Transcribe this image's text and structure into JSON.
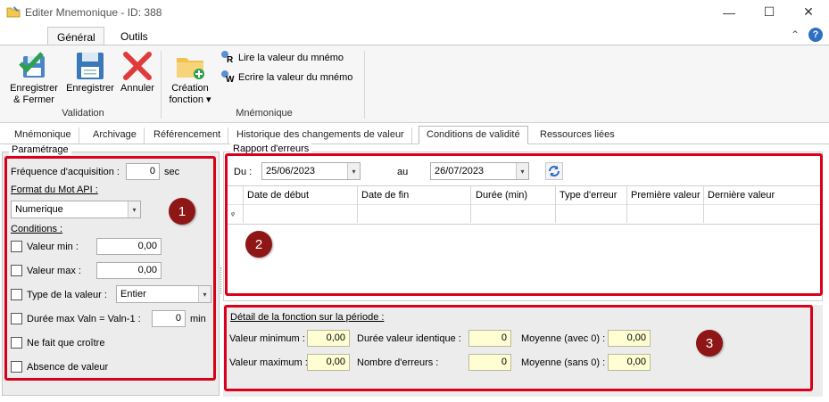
{
  "window": {
    "title": "Editer Mnemonique - ID: 388",
    "minimize": "—",
    "maximize": "☐",
    "close": "✕"
  },
  "ribbon": {
    "tabs": [
      "Général",
      "Outils"
    ],
    "collapse_glyph": "⌃",
    "help_glyph": "?",
    "validation": {
      "group_label": "Validation",
      "save_close": [
        "Enregistrer",
        "& Fermer"
      ],
      "save": "Enregistrer",
      "cancel": "Annuler"
    },
    "mnemonique": {
      "group_label": "Mnémonique",
      "create_function": [
        "Création",
        "fonction"
      ],
      "dropdown_glyph": "▾",
      "read_value": "Lire la valeur du mnémo",
      "write_value": "Ecrire la valeur du mnémo",
      "read_letter": "R",
      "write_letter": "W"
    }
  },
  "tabs": [
    "Mnémonique",
    "Archivage",
    "Référencement",
    "Historique des changements de valeur",
    "Conditions de validité",
    "Ressources liées"
  ],
  "active_tab_index": 4,
  "parametrage": {
    "title": "Paramétrage",
    "frequency_label": "Fréquence d'acquisition :",
    "frequency_value": "0",
    "frequency_unit": "sec",
    "format_label": "Format du Mot API :",
    "format_value": "Numerique",
    "conditions_label": "Conditions :",
    "valeur_min_label": "Valeur min :",
    "valeur_min_value": "0,00",
    "valeur_max_label": "Valeur max :",
    "valeur_max_value": "0,00",
    "type_label": "Type de la valeur :",
    "type_value": "Entier",
    "duree_label": "Durée max Valn = Valn-1 :",
    "duree_value": "0",
    "duree_unit": "min",
    "croitre_label": "Ne fait que croître",
    "absence_label": "Absence de valeur",
    "combo_arrow": "▾"
  },
  "rapport": {
    "title": "Rapport d'erreurs",
    "du_label": "Du :",
    "du_value": "25/06/2023",
    "au_label": "au",
    "au_value": "26/07/2023",
    "columns": [
      "Date de début",
      "Date de fin",
      "Durée (min)",
      "Type d'erreur",
      "Première valeur",
      "Dernière valeur"
    ],
    "filter_glyph": "ᵩ"
  },
  "detail": {
    "title": "Détail de la fonction sur la période :",
    "valeur_minimum_label": "Valeur minimum :",
    "valeur_minimum_value": "0,00",
    "valeur_maximum_label": "Valeur maximum :",
    "valeur_maximum_value": "0,00",
    "duree_identique_label": "Durée valeur identique :",
    "duree_identique_value": "0",
    "nombre_erreurs_label": "Nombre d'erreurs :",
    "nombre_erreurs_value": "0",
    "moyenne_avec_label": "Moyenne (avec 0) :",
    "moyenne_avec_value": "0,00",
    "moyenne_sans_label": "Moyenne (sans 0) :",
    "moyenne_sans_value": "0,00"
  },
  "badges": [
    "1",
    "2",
    "3"
  ],
  "colors": {
    "annotation_red": "#d9001b",
    "badge_bg": "#8e1616",
    "highlight_yellow": "#fefed2",
    "save_blue": "#3a78b8",
    "check_green": "#2e9e4f"
  }
}
